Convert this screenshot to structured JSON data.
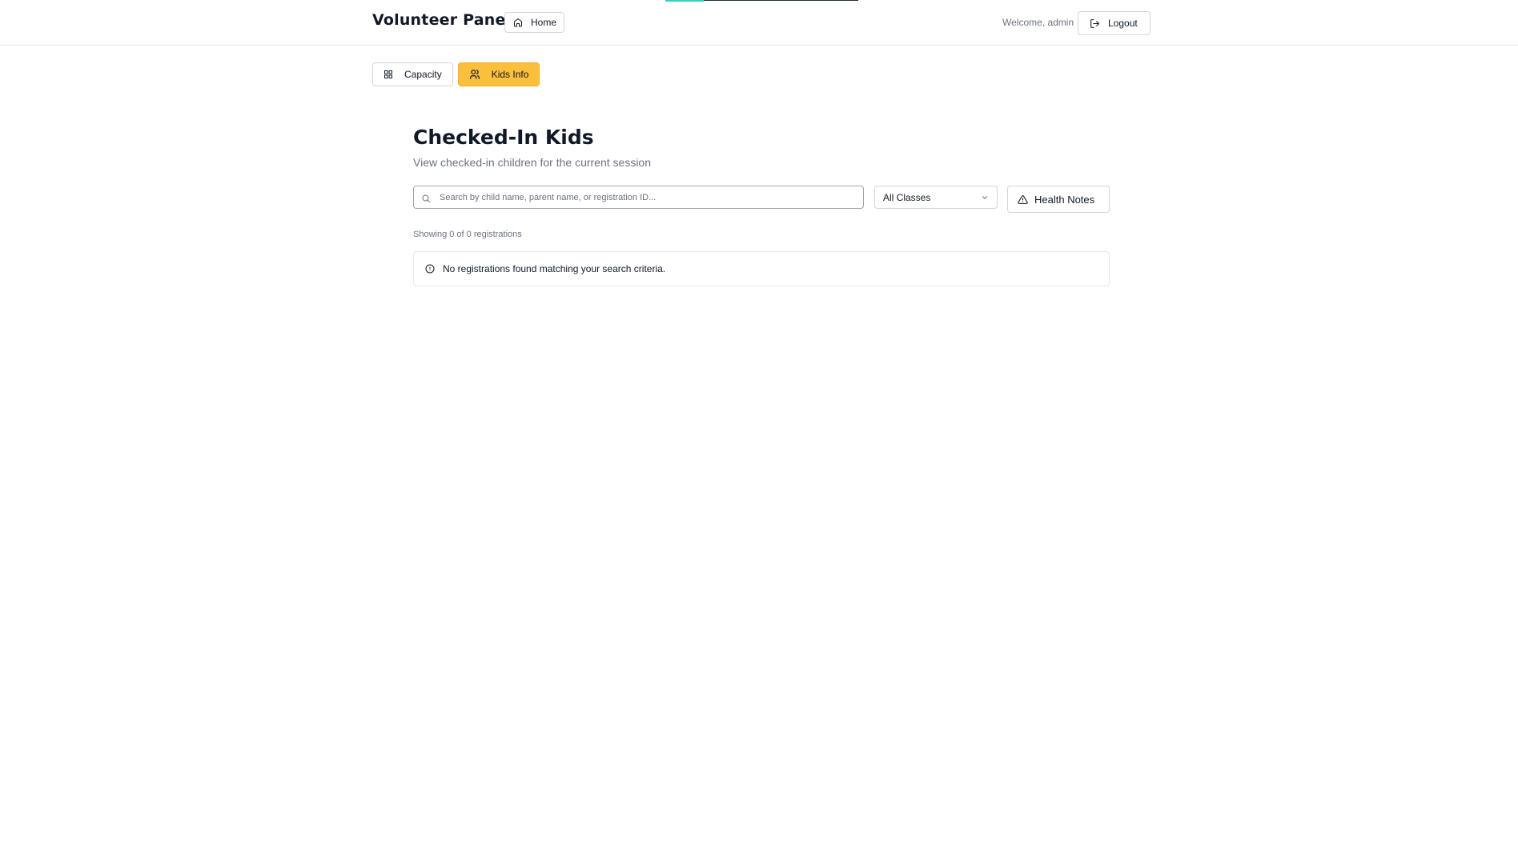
{
  "header": {
    "brand": "Volunteer Panel",
    "home_label": "Home",
    "welcome": "Welcome, admin",
    "logout_label": "Logout"
  },
  "tabs": [
    {
      "label": "Capacity",
      "icon": "grid-icon",
      "active": false
    },
    {
      "label": "Kids Info",
      "icon": "users-icon",
      "active": true
    }
  ],
  "main": {
    "title": "Checked-In Kids",
    "subtitle": "View checked-in children for the current session",
    "search": {
      "placeholder": "Search by child name, parent name, or registration ID...",
      "value": ""
    },
    "class_filter": {
      "selected": "All Classes"
    },
    "health_notes_label": "Health Notes",
    "showing": "Showing 0 of 0 registrations",
    "empty_message": "No registrations found matching your search criteria."
  },
  "colors": {
    "accent": "#fbbf3c",
    "border": "#d1d5db",
    "muted_text": "#6b7280",
    "loading_bar": "#2dd4bf"
  }
}
